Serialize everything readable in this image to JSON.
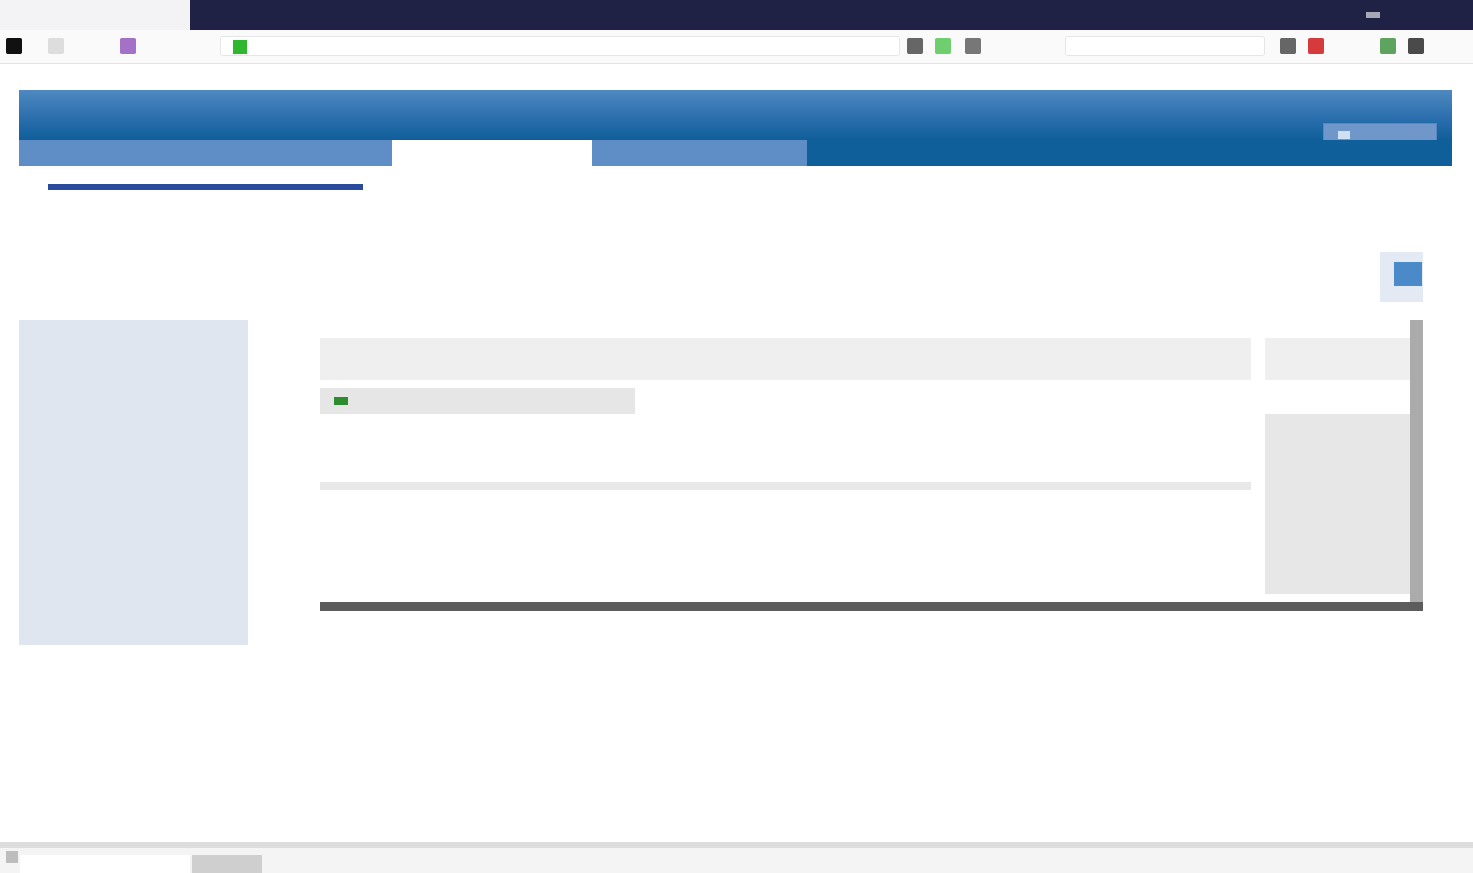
{
  "browser": {
    "tab_titles": [
      "",
      "",
      ""
    ],
    "address": "",
    "search_placeholder": ""
  },
  "site": {
    "banner_title": "",
    "banner_right": "",
    "tabs": [
      {
        "label": ""
      },
      {
        "label": ""
      },
      {
        "label": ""
      }
    ]
  },
  "page": {
    "breadcrumb": "",
    "utility_links": [
      "",
      "",
      "",
      "",
      "",
      ""
    ],
    "utility_sub": "",
    "heading": ""
  },
  "sidebar": {
    "items": [
      {
        "label": ""
      },
      {
        "label": ""
      },
      {
        "label": ""
      },
      {
        "label": ""
      },
      {
        "label": ""
      },
      {
        "label": ""
      },
      {
        "label": ""
      },
      {
        "label": ""
      },
      {
        "label": ""
      }
    ]
  },
  "table": {
    "title": "",
    "headers": [
      "",
      "",
      "",
      "",
      "",
      "",
      "",
      ""
    ],
    "right_header": "",
    "group_label": "",
    "rows": [
      {
        "cells": [
          "",
          "",
          "",
          "",
          "",
          "",
          "",
          ""
        ]
      },
      {
        "cells": [
          "",
          "",
          "",
          "",
          "",
          "",
          "",
          ""
        ]
      },
      {
        "cells": [
          "",
          "",
          "",
          "",
          "",
          "",
          "",
          ""
        ]
      },
      {
        "cells": [
          "",
          "",
          "",
          "",
          "",
          "",
          "",
          ""
        ]
      },
      {
        "cells": [
          "",
          "",
          "",
          "",
          "",
          "",
          "",
          ""
        ]
      }
    ],
    "right_cells": [
      "",
      "",
      "",
      "",
      ""
    ]
  },
  "footer": {
    "left": "",
    "right": ""
  },
  "status": {
    "text": ""
  },
  "colors": {
    "titlebar": "#1f2244",
    "banner": "#0f5f9a",
    "sidebar": "#dfe6ef",
    "link": "#3a6fc4"
  }
}
